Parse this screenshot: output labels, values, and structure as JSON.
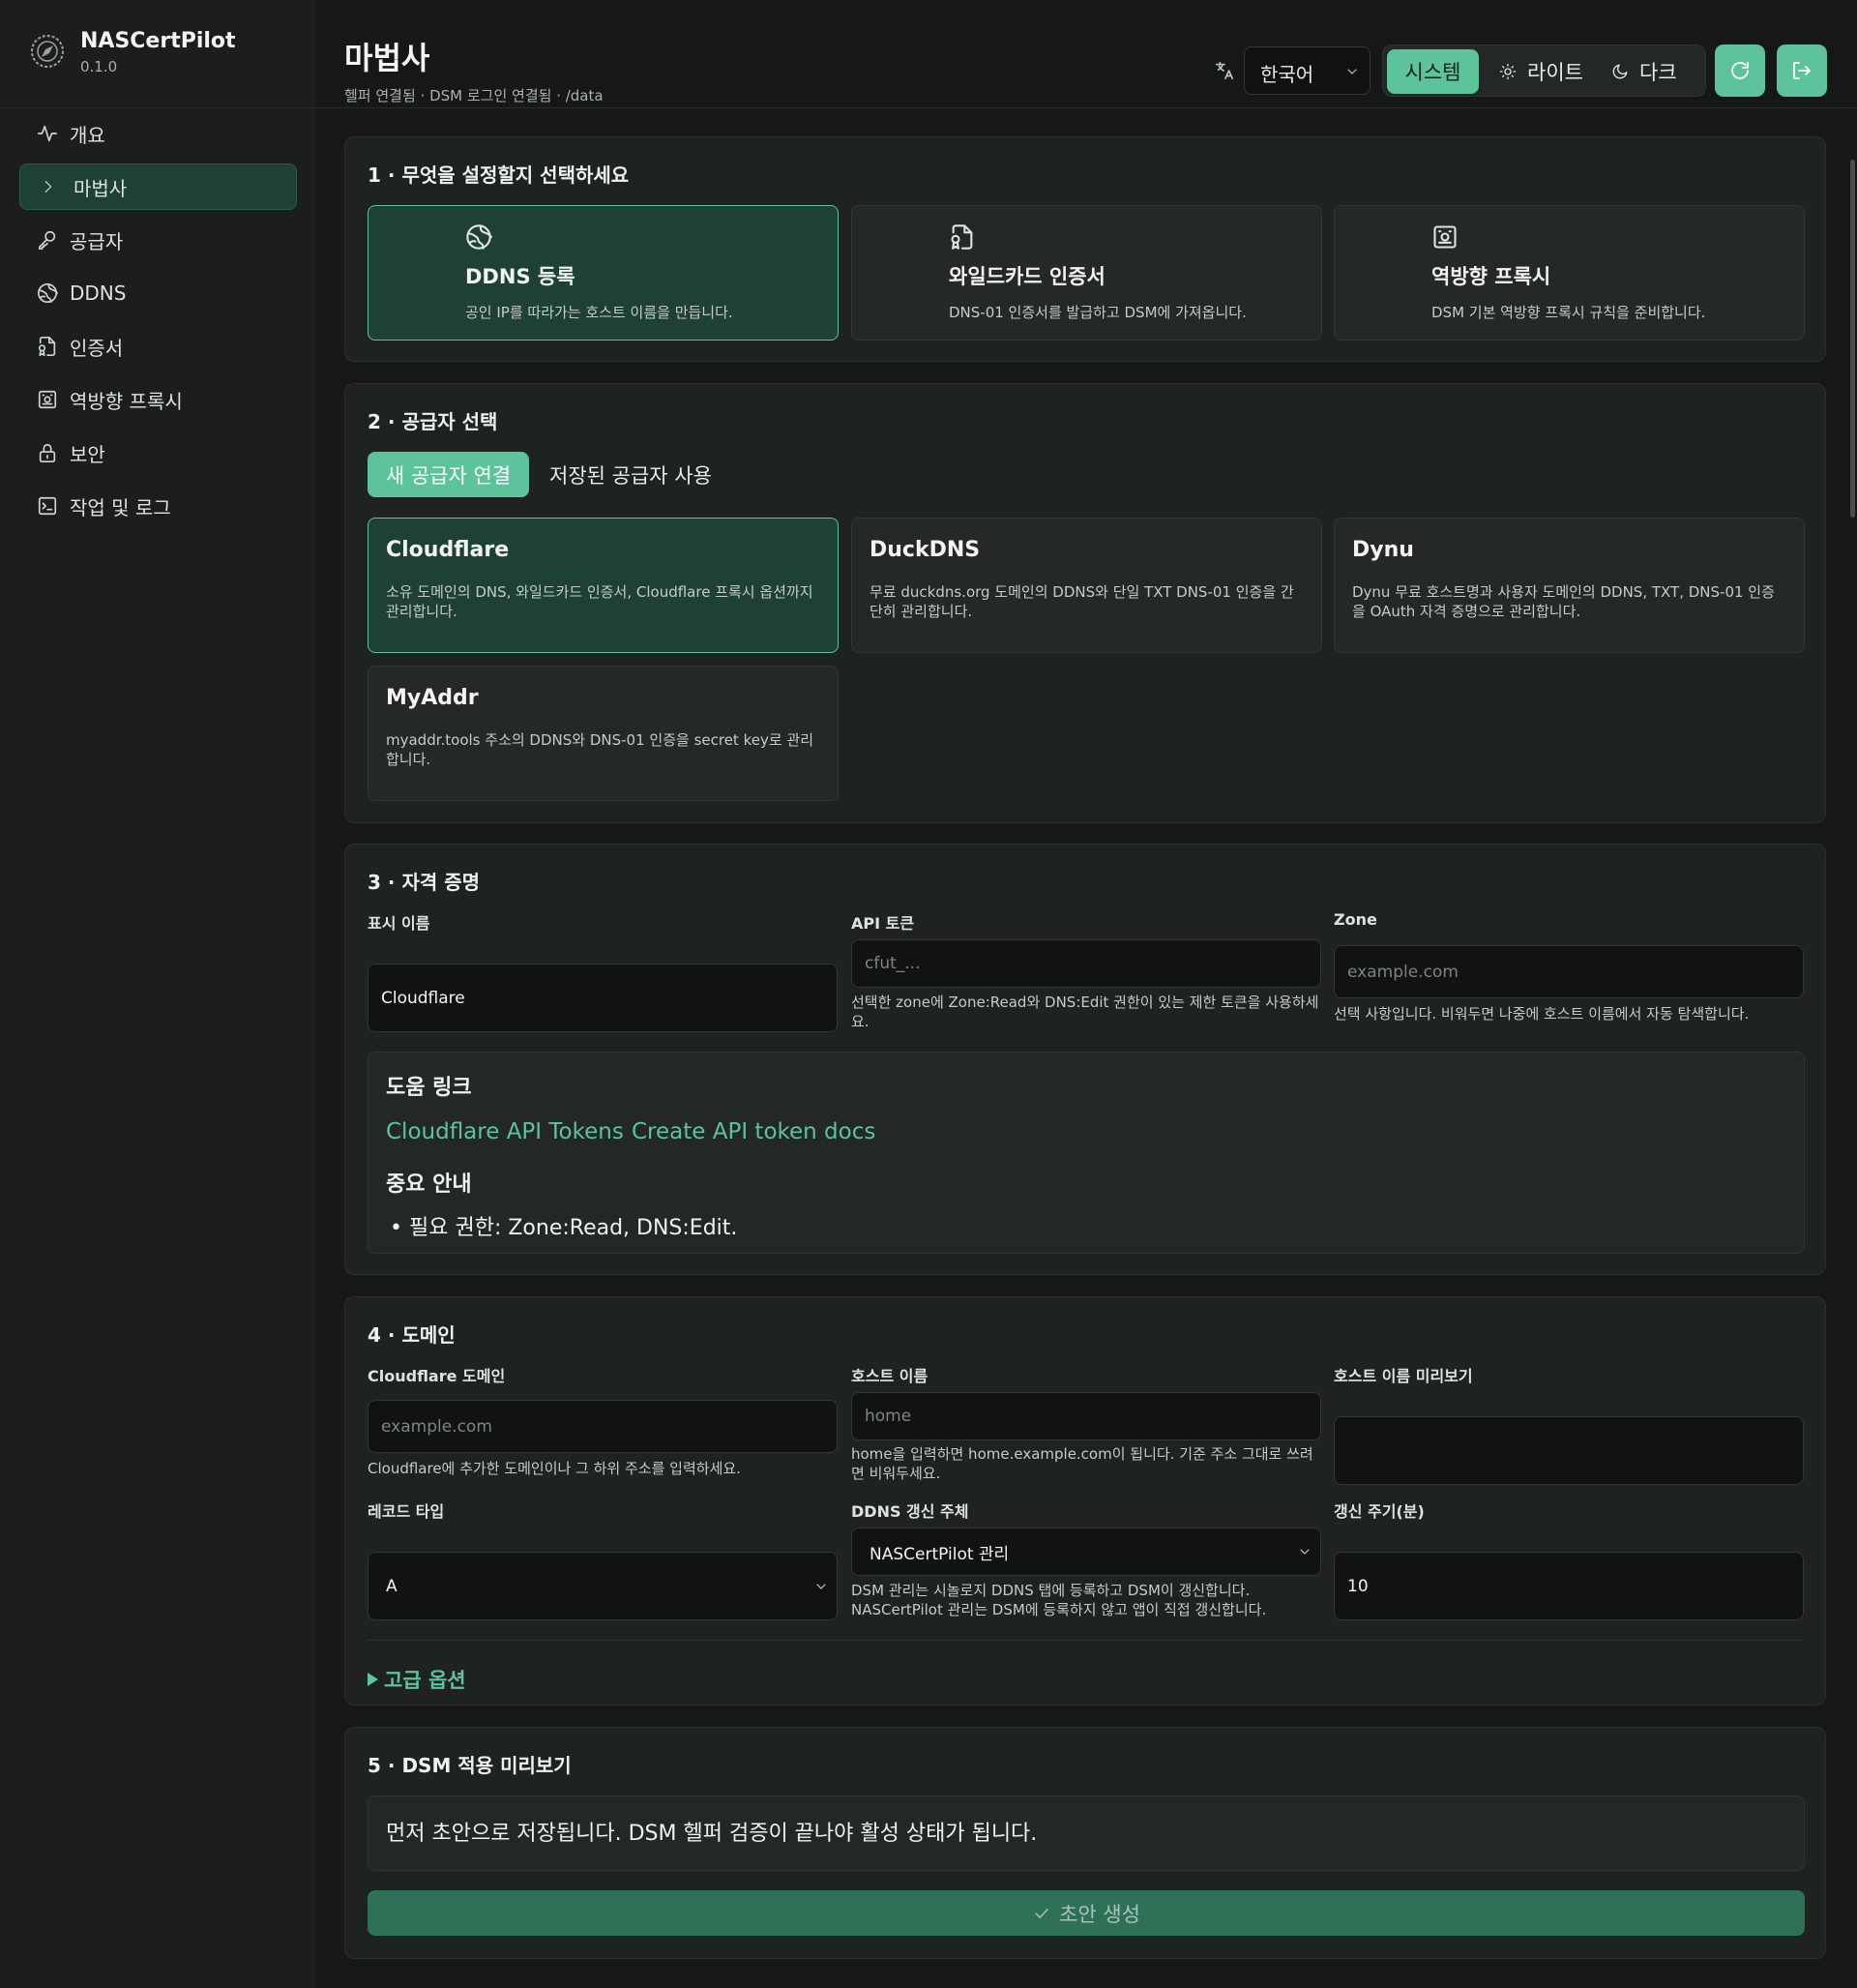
{
  "app": {
    "name": "NASCertPilot",
    "version": "0.1.0"
  },
  "sidebar": {
    "items": [
      {
        "label": "개요",
        "icon": "activity-icon"
      },
      {
        "label": "마법사",
        "icon": "chevron-right-icon",
        "active": true
      },
      {
        "label": "공급자",
        "icon": "key-icon"
      },
      {
        "label": "DDNS",
        "icon": "globe-icon"
      },
      {
        "label": "인증서",
        "icon": "file-cert-icon"
      },
      {
        "label": "역방향 프록시",
        "icon": "proxy-icon"
      },
      {
        "label": "보안",
        "icon": "lock-icon"
      },
      {
        "label": "작업 및 로그",
        "icon": "terminal-icon"
      }
    ]
  },
  "header": {
    "title": "마법사",
    "subtitle": "헬퍼 연결됨 · DSM 로그인 연결됨 · /data",
    "language": "한국어",
    "theme": {
      "system": "시스템",
      "light": "라이트",
      "dark": "다크",
      "selected": "시스템"
    }
  },
  "colors": {
    "accent": "#5cc39b",
    "selected_bg": "#1f4034",
    "panel": "#1e2221",
    "background": "#161817"
  },
  "step1": {
    "title": "1 · 무엇을 설정할지 선택하세요",
    "cards": [
      {
        "title": "DDNS 등록",
        "desc": "공인 IP를 따라가는 호스트 이름을 만듭니다.",
        "icon": "globe-icon",
        "selected": true
      },
      {
        "title": "와일드카드 인증서",
        "desc": "DNS-01 인증서를 발급하고 DSM에 가져옵니다.",
        "icon": "file-cert-icon",
        "selected": false
      },
      {
        "title": "역방향 프록시",
        "desc": "DSM 기본 역방향 프록시 규칙을 준비합니다.",
        "icon": "proxy-icon",
        "selected": false
      }
    ]
  },
  "step2": {
    "title": "2 · 공급자 선택",
    "tabs": {
      "new": "새 공급자 연결",
      "saved": "저장된 공급자 사용"
    },
    "providers": [
      {
        "name": "Cloudflare",
        "desc": "소유 도메인의 DNS, 와일드카드 인증서, Cloudflare 프록시 옵션까지 관리합니다.",
        "selected": true
      },
      {
        "name": "DuckDNS",
        "desc": "무료 duckdns.org 도메인의 DDNS와 단일 TXT DNS-01 인증을 간단히 관리합니다.",
        "selected": false
      },
      {
        "name": "Dynu",
        "desc": "Dynu 무료 호스트명과 사용자 도메인의 DDNS, TXT, DNS-01 인증을 OAuth 자격 증명으로 관리합니다.",
        "selected": false
      },
      {
        "name": "MyAddr",
        "desc": "myaddr.tools 주소의 DDNS와 DNS-01 인증을 secret key로 관리합니다.",
        "selected": false
      }
    ]
  },
  "step3": {
    "title": "3 · 자격 증명",
    "display_name": {
      "label": "표시 이름",
      "value": "Cloudflare"
    },
    "api_token": {
      "label": "API 토큰",
      "placeholder": "cfut_...",
      "help": "선택한 zone에 Zone:Read와 DNS:Edit 권한이 있는 제한 토큰을 사용하세요."
    },
    "zone": {
      "label": "Zone",
      "placeholder": "example.com",
      "help": "선택 사항입니다. 비워두면 나중에 호스트 이름에서 자동 탐색합니다."
    },
    "help_links": {
      "title": "도움 링크",
      "links": [
        "Cloudflare API Tokens",
        "Create API token docs"
      ],
      "notice_title": "중요 안내",
      "notice": "필요 권한: Zone:Read, DNS:Edit."
    }
  },
  "step4": {
    "title": "4 · 도메인",
    "domain": {
      "label": "Cloudflare 도메인",
      "placeholder": "example.com",
      "help": "Cloudflare에 추가한 도메인이나 그 하위 주소를 입력하세요."
    },
    "hostname": {
      "label": "호스트 이름",
      "placeholder": "home",
      "help": "home을 입력하면 home.example.com이 됩니다. 기준 주소 그대로 쓰려면 비워두세요."
    },
    "hostname_preview": {
      "label": "호스트 이름 미리보기",
      "value": ""
    },
    "record_type": {
      "label": "레코드 타입",
      "value": "A"
    },
    "ddns_owner": {
      "label": "DDNS 갱신 주체",
      "value": "NASCertPilot 관리",
      "help": "DSM 관리는 시놀로지 DDNS 탭에 등록하고 DSM이 갱신합니다. NASCertPilot 관리는 DSM에 등록하지 않고 앱이 직접 갱신합니다."
    },
    "interval": {
      "label": "갱신 주기(분)",
      "value": "10"
    },
    "advanced": "고급 옵션"
  },
  "step5": {
    "title": "5 · DSM 적용 미리보기",
    "preview_text": "먼저 초안으로 저장됩니다. DSM 헬퍼 검증이 끝나야 활성 상태가 됩니다.",
    "draft_button": "초안 생성"
  }
}
